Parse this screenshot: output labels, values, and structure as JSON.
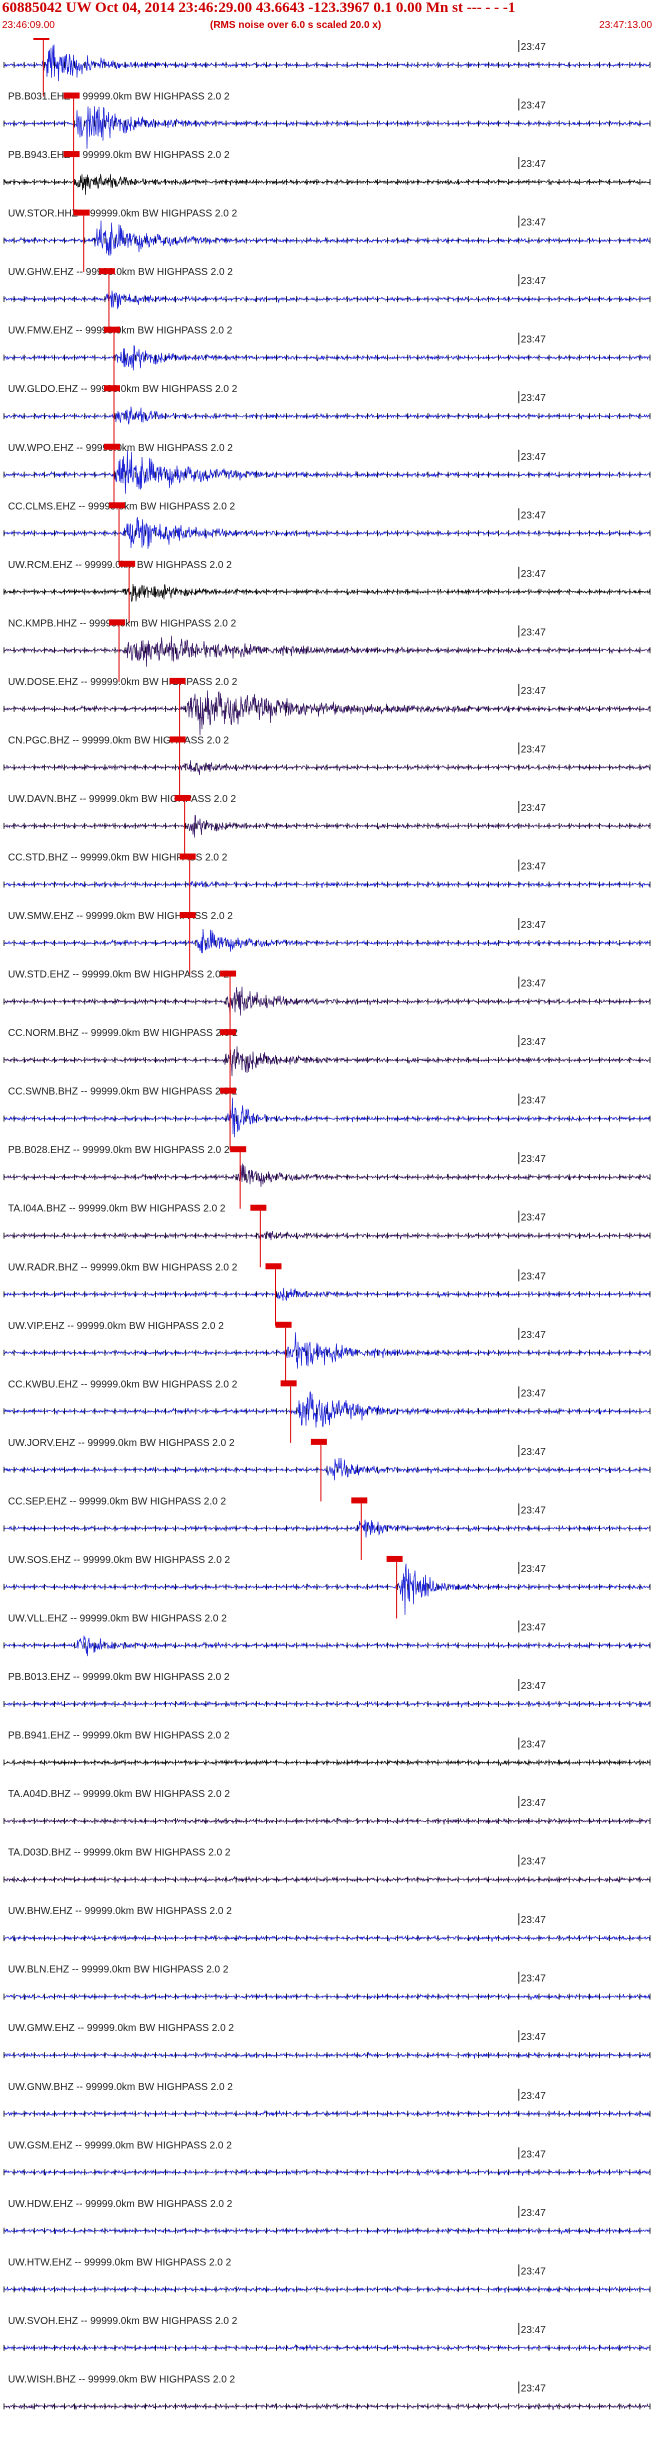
{
  "header": {
    "title": "60885042 UW Oct 04, 2014 23:46:29.00   43.6643 -123.3967  0.1 0.00 Mn st --- - -   -1",
    "start_time": "23:46:09.00",
    "note": "(RMS noise over 6.0 s scaled 20.0 x)",
    "end_time": "23:47:13.00"
  },
  "colors": {
    "text": "#cc0000",
    "blue": "#1f24d6",
    "black": "#111111",
    "purple": "#3a1a66",
    "pick_box": "#dd0000"
  },
  "chart_data": {
    "type": "line",
    "title": "60885042 UW Oct 04, 2014 23:46:29.00   43.6643 -123.3967  0.1 0.00 Mn st --- - -   -1",
    "x_range_seconds": [
      0,
      64
    ],
    "minute_mark_label": "23:47",
    "minute_mark_seconds": 51,
    "traces": [
      {
        "label": "",
        "pick_s": 3.5,
        "event_s": 4,
        "dur_s": 8,
        "amp": 0.9,
        "color": "blue"
      },
      {
        "label": "PB.B031.EHZ -- 99999.0km BW  HIGHPASS  2.0  2",
        "pick_s": 6.5,
        "event_s": 7,
        "dur_s": 10,
        "amp": 1.0,
        "color": "blue"
      },
      {
        "label": "PB.B943.EHZ -- 99999.0km BW  HIGHPASS  2.0  2",
        "pick_s": 6.5,
        "event_s": 7,
        "dur_s": 8,
        "amp": 0.5,
        "color": "black"
      },
      {
        "label": "UW.STOR.HHZ -- 99999.0km BW  HIGHPASS  2.0  2",
        "pick_s": 7.5,
        "event_s": 9,
        "dur_s": 10,
        "amp": 0.9,
        "color": "blue"
      },
      {
        "label": "UW.GHW.EHZ -- 99999.0km BW  HIGHPASS  2.0  2",
        "pick_s": 10,
        "event_s": 10,
        "dur_s": 6,
        "amp": 0.5,
        "color": "blue"
      },
      {
        "label": "UW.FMW.EHZ -- 99999.0km BW  HIGHPASS  2.0  2",
        "pick_s": 10.5,
        "event_s": 11,
        "dur_s": 8,
        "amp": 0.6,
        "color": "blue"
      },
      {
        "label": "UW.GLDO.EHZ -- 99999.0km BW  HIGHPASS  2.0  2",
        "pick_s": 10.5,
        "event_s": 11,
        "dur_s": 6,
        "amp": 0.5,
        "color": "blue"
      },
      {
        "label": "UW.WPO.EHZ -- 99999.0km BW  HIGHPASS  2.0  2",
        "pick_s": 10.5,
        "event_s": 11,
        "dur_s": 14,
        "amp": 1.0,
        "color": "blue"
      },
      {
        "label": "CC.CLMS.EHZ -- 99999.0km BW  HIGHPASS  2.0  2",
        "pick_s": 11,
        "event_s": 12,
        "dur_s": 10,
        "amp": 1.0,
        "color": "blue"
      },
      {
        "label": "UW.RCM.EHZ -- 99999.0km BW  HIGHPASS  2.0  2",
        "pick_s": 12,
        "event_s": 12,
        "dur_s": 8,
        "amp": 0.6,
        "color": "black"
      },
      {
        "label": "NC.KMPB.HHZ -- 99999.0km BW  HIGHPASS  2.0  2",
        "pick_s": 11,
        "event_s": 12,
        "dur_s": 22,
        "amp": 0.7,
        "color": "purple"
      },
      {
        "label": "UW.DOSE.EHZ -- 99999.0km BW  HIGHPASS  2.0  2",
        "pick_s": 17,
        "event_s": 18,
        "dur_s": 22,
        "amp": 1.0,
        "color": "purple"
      },
      {
        "label": "CN.PGC.BHZ -- 99999.0km BW  HIGHPASS  2.0  2",
        "pick_s": 17,
        "event_s": 17.5,
        "dur_s": 6,
        "amp": 0.4,
        "color": "purple"
      },
      {
        "label": "UW.DAVN.BHZ -- 99999.0km BW  HIGHPASS  2.0  2",
        "pick_s": 17.5,
        "event_s": 18,
        "dur_s": 6,
        "amp": 0.4,
        "color": "purple"
      },
      {
        "label": "CC.STD.BHZ -- 99999.0km BW  HIGHPASS  2.0  2",
        "pick_s": 18,
        "event_s": 18,
        "dur_s": 4,
        "amp": 0.1,
        "color": "blue"
      },
      {
        "label": "UW.SMW.EHZ -- 99999.0km BW  HIGHPASS  2.0  2",
        "pick_s": 18,
        "event_s": 19,
        "dur_s": 8,
        "amp": 0.6,
        "color": "blue"
      },
      {
        "label": "UW.STD.EHZ -- 99999.0km BW  HIGHPASS  2.0  2",
        "pick_s": 22,
        "event_s": 22,
        "dur_s": 7,
        "amp": 0.8,
        "color": "purple"
      },
      {
        "label": "CC.NORM.BHZ -- 99999.0km BW  HIGHPASS  2.0  2",
        "pick_s": 22,
        "event_s": 22,
        "dur_s": 8,
        "amp": 0.7,
        "color": "purple"
      },
      {
        "label": "CC.SWNB.BHZ -- 99999.0km BW  HIGHPASS  2.0  2",
        "pick_s": 22,
        "event_s": 22,
        "dur_s": 4,
        "amp": 0.8,
        "color": "blue"
      },
      {
        "label": "PB.B028.EHZ -- 99999.0km BW  HIGHPASS  2.0  2",
        "pick_s": 23,
        "event_s": 23,
        "dur_s": 6,
        "amp": 0.6,
        "color": "purple"
      },
      {
        "label": "TA.I04A.BHZ -- 99999.0km BW  HIGHPASS  2.0  2",
        "pick_s": 25,
        "event_s": 25,
        "dur_s": 6,
        "amp": 0.2,
        "color": "purple"
      },
      {
        "label": "UW.RADR.BHZ -- 99999.0km BW  HIGHPASS  2.0  2",
        "pick_s": 26.5,
        "event_s": 27,
        "dur_s": 5,
        "amp": 0.3,
        "color": "blue"
      },
      {
        "label": "UW.VIP.EHZ -- 99999.0km BW  HIGHPASS  2.0  2",
        "pick_s": 27.5,
        "event_s": 28,
        "dur_s": 10,
        "amp": 0.8,
        "color": "blue"
      },
      {
        "label": "CC.KWBU.EHZ -- 99999.0km BW  HIGHPASS  2.0  2",
        "pick_s": 28,
        "event_s": 29,
        "dur_s": 10,
        "amp": 1.0,
        "color": "blue"
      },
      {
        "label": "UW.JORV.EHZ -- 99999.0km BW  HIGHPASS  2.0  2",
        "pick_s": 31,
        "event_s": 32,
        "dur_s": 6,
        "amp": 0.5,
        "color": "blue"
      },
      {
        "label": "CC.SEP.EHZ -- 99999.0km BW  HIGHPASS  2.0  2",
        "pick_s": 35,
        "event_s": 35,
        "dur_s": 5,
        "amp": 0.4,
        "color": "blue"
      },
      {
        "label": "UW.SOS.EHZ -- 99999.0km BW  HIGHPASS  2.0  2",
        "pick_s": 38.5,
        "event_s": 39,
        "dur_s": 5,
        "amp": 1.0,
        "color": "blue"
      },
      {
        "label": "UW.VLL.EHZ -- 99999.0km BW  HIGHPASS  2.0  2",
        "pick_s": -1,
        "event_s": 7,
        "dur_s": 6,
        "amp": 0.5,
        "color": "blue"
      },
      {
        "label": "PB.B013.EHZ -- 99999.0km BW  HIGHPASS  2.0  2",
        "pick_s": -1,
        "event_s": -1,
        "dur_s": 0,
        "amp": 0,
        "color": "blue"
      },
      {
        "label": "PB.B941.EHZ -- 99999.0km BW  HIGHPASS  2.0  2",
        "pick_s": -1,
        "event_s": -1,
        "dur_s": 0,
        "amp": 0,
        "color": "black"
      },
      {
        "label": "TA.A04D.BHZ -- 99999.0km BW  HIGHPASS  2.0  2",
        "pick_s": -1,
        "event_s": -1,
        "dur_s": 0,
        "amp": 0,
        "color": "purple"
      },
      {
        "label": "TA.D03D.BHZ -- 99999.0km BW  HIGHPASS  2.0  2",
        "pick_s": -1,
        "event_s": -1,
        "dur_s": 0,
        "amp": 0,
        "color": "purple"
      },
      {
        "label": "UW.BHW.EHZ -- 99999.0km BW  HIGHPASS  2.0  2",
        "pick_s": -1,
        "event_s": -1,
        "dur_s": 0,
        "amp": 0,
        "color": "blue"
      },
      {
        "label": "UW.BLN.EHZ -- 99999.0km BW  HIGHPASS  2.0  2",
        "pick_s": -1,
        "event_s": -1,
        "dur_s": 0,
        "amp": 0,
        "color": "blue"
      },
      {
        "label": "UW.GMW.EHZ -- 99999.0km BW  HIGHPASS  2.0  2",
        "pick_s": -1,
        "event_s": -1,
        "dur_s": 0,
        "amp": 0,
        "color": "blue"
      },
      {
        "label": "UW.GNW.BHZ -- 99999.0km BW  HIGHPASS  2.0  2",
        "pick_s": -1,
        "event_s": -1,
        "dur_s": 0,
        "amp": 0,
        "color": "blue"
      },
      {
        "label": "UW.GSM.EHZ -- 99999.0km BW  HIGHPASS  2.0  2",
        "pick_s": -1,
        "event_s": -1,
        "dur_s": 0,
        "amp": 0,
        "color": "blue"
      },
      {
        "label": "UW.HDW.EHZ -- 99999.0km BW  HIGHPASS  2.0  2",
        "pick_s": -1,
        "event_s": -1,
        "dur_s": 0,
        "amp": 0,
        "color": "blue"
      },
      {
        "label": "UW.HTW.EHZ -- 99999.0km BW  HIGHPASS  2.0  2",
        "pick_s": -1,
        "event_s": -1,
        "dur_s": 0,
        "amp": 0,
        "color": "blue"
      },
      {
        "label": "UW.SVOH.EHZ -- 99999.0km BW  HIGHPASS  2.0  2",
        "pick_s": -1,
        "event_s": -1,
        "dur_s": 0,
        "amp": 0,
        "color": "blue"
      },
      {
        "label": "UW.WISH.BHZ -- 99999.0km BW  HIGHPASS  2.0  2",
        "pick_s": -1,
        "event_s": -1,
        "dur_s": 0,
        "amp": 0,
        "color": "purple"
      }
    ]
  }
}
